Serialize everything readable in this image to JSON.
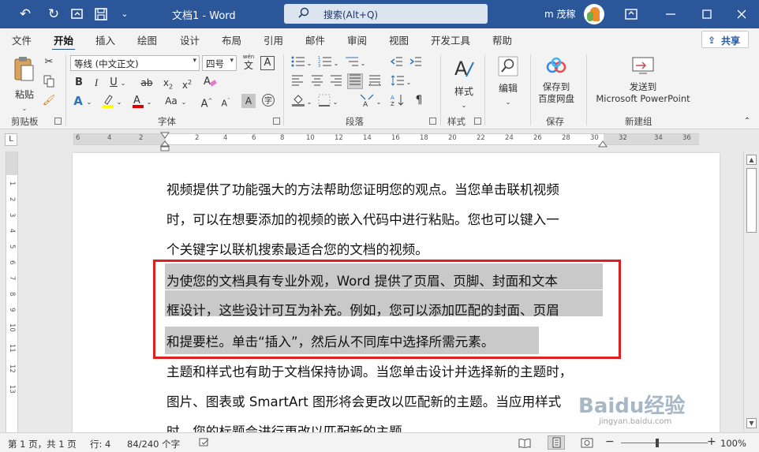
{
  "titlebar": {
    "doc_title": "文档1  -  Word",
    "search_placeholder": "搜索(Alt+Q)",
    "user_name": "m 茂稼"
  },
  "tabs": [
    "文件",
    "开始",
    "插入",
    "绘图",
    "设计",
    "布局",
    "引用",
    "邮件",
    "审阅",
    "视图",
    "开发工具",
    "帮助"
  ],
  "share_label": "共享",
  "ribbon": {
    "clipboard": {
      "paste_label": "粘贴",
      "group_label": "剪贴板"
    },
    "font": {
      "font_name": "等线 (中文正文)",
      "font_size": "四号",
      "wen_label": "wén",
      "wen_char": "文",
      "wen_box": "A",
      "group_label": "字体"
    },
    "paragraph": {
      "group_label": "段落"
    },
    "styles": {
      "button_label": "样式",
      "group_label": "样式"
    },
    "editing": {
      "button_label": "编辑"
    },
    "save": {
      "button_label_1": "保存到",
      "button_label_2": "百度网盘",
      "group_label": "保存"
    },
    "send": {
      "button_label_1": "发送到",
      "button_label_2": "Microsoft PowerPoint",
      "group_label": "新建组"
    }
  },
  "ruler": {
    "tab_selector": "L",
    "numbers": [
      "6",
      "4",
      "2",
      "2",
      "4",
      "6",
      "8",
      "10",
      "12",
      "14",
      "16",
      "18",
      "20",
      "22",
      "24",
      "26",
      "28",
      "30",
      "32",
      "34",
      "36"
    ],
    "vertical_numbers": [
      "1",
      "2",
      "3",
      "4",
      "5",
      "6",
      "7",
      "8",
      "9",
      "10",
      "11",
      "12",
      "13"
    ]
  },
  "document": {
    "lines": [
      "视频提供了功能强大的方法帮助您证明您的观点。当您单击联机视频",
      "时，可以在想要添加的视频的嵌入代码中进行粘贴。您也可以键入一",
      "个关键字以联机搜索最适合您的文档的视频。",
      "为使您的文档具有专业外观，Word 提供了页眉、页脚、封面和文本",
      "框设计，这些设计可互为补充。例如，您可以添加匹配的封面、页眉",
      "和提要栏。单击“插入”，然后从不同库中选择所需元素。",
      "主题和样式也有助于文档保持协调。当您单击设计并选择新的主题时，",
      "图片、图表或 SmartArt 图形将会更改以匹配新的主题。当应用样式",
      "时，您的标题会进行更改以匹配新的主题。"
    ],
    "highlight_color": "#c9c9c9",
    "callout_color": "#e02020"
  },
  "watermark": {
    "main": "Baidu经验",
    "sub": "jingyan.baidu.com"
  },
  "statusbar": {
    "page": "第 1 页，共 1 页",
    "line": "行: 4",
    "words": "84/240 个字",
    "zoom": "100%"
  },
  "colors": {
    "accent": "#2b579a",
    "ribbon_bg": "#f3f3f3"
  }
}
